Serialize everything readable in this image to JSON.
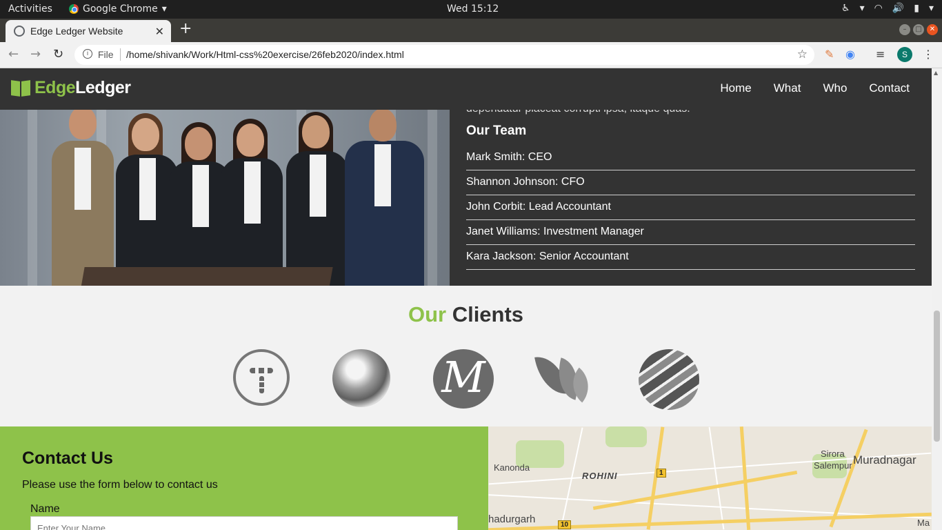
{
  "system": {
    "activities": "Activities",
    "app_name": "Google Chrome",
    "clock": "Wed 15:12"
  },
  "browser": {
    "tab_title": "Edge Ledger Website",
    "file_label": "File",
    "url": "/home/shivank/Work/Html-css%20exercise/26feb2020/index.html",
    "profile_initial": "S"
  },
  "site": {
    "logo_edge": "Edge",
    "logo_ledger": "Ledger",
    "nav": [
      "Home",
      "What",
      "Who",
      "Contact"
    ],
    "truncated_text": "dependatur placeat corrupti ipsa, itaque quas.",
    "team_heading": "Our Team",
    "team": [
      "Mark Smith: CEO",
      "Shannon Johnson: CFO",
      "John Corbit: Lead Accountant",
      "Janet Williams: Investment Manager",
      "Kara Jackson: Senior Accountant"
    ],
    "clients_heading_our": "Our",
    "clients_heading_rest": " Clients",
    "client_logo_letter": "M",
    "contact": {
      "heading": "Contact Us",
      "subtext": "Please use the form below to contact us",
      "name_label": "Name",
      "name_placeholder": "Enter Your Name"
    },
    "map_labels": [
      "Kanonda",
      "ROHINI",
      "Sirora",
      "Salempur",
      "Muradnagar",
      "hadurgarh",
      "Ma"
    ],
    "map_shields": [
      "1",
      "10"
    ]
  },
  "colors": {
    "accent_green": "#8ec24a",
    "header_dark": "#333333"
  }
}
